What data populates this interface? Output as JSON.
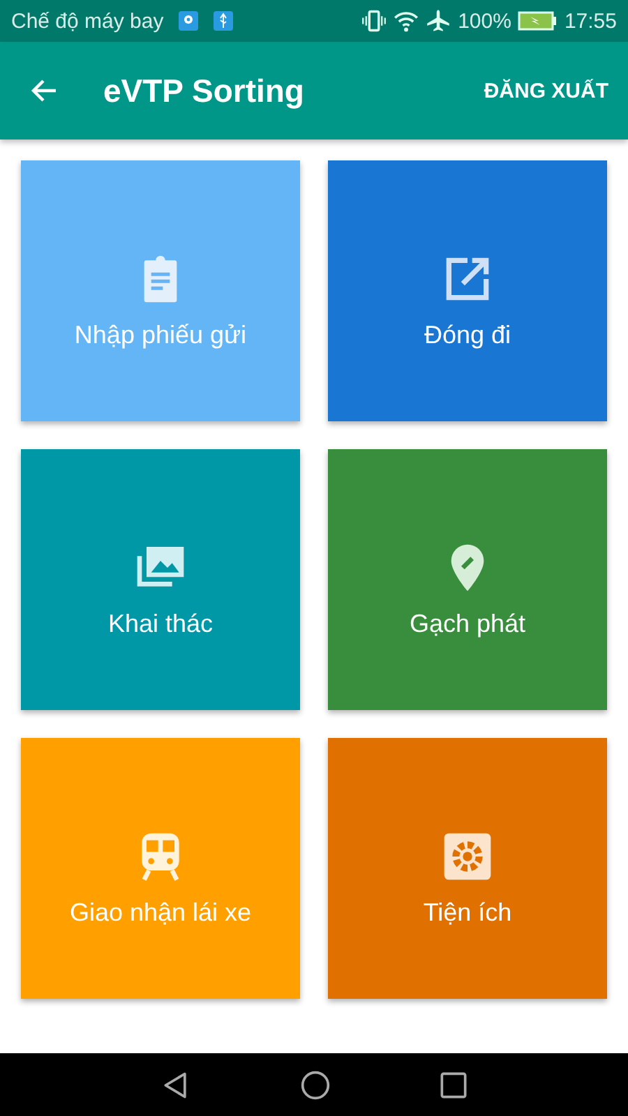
{
  "status_bar": {
    "carrier": "Chế độ máy bay",
    "battery": "100%",
    "time": "17:55"
  },
  "app_bar": {
    "title": "eVTP Sorting",
    "action": "ĐĂNG XUẤT"
  },
  "tiles": [
    {
      "label": "Nhập phiếu gửi",
      "color": "#64b5f6"
    },
    {
      "label": "Đóng đi",
      "color": "#1976d2"
    },
    {
      "label": "Khai thác",
      "color": "#0097a7"
    },
    {
      "label": "Gạch phát",
      "color": "#388e3c"
    },
    {
      "label": "Giao nhận lái xe",
      "color": "#ffa000"
    },
    {
      "label": "Tiện ích",
      "color": "#e07000"
    }
  ]
}
